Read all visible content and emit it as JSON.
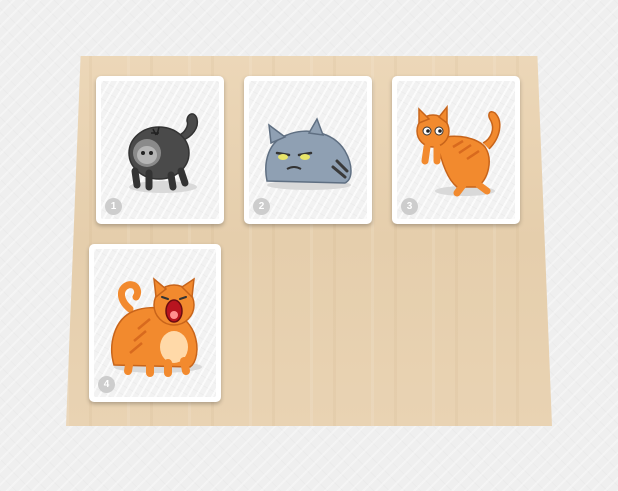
{
  "cards": [
    {
      "number": "1",
      "cat": "black-cat-icon"
    },
    {
      "number": "2",
      "cat": "grumpy-gray-cat-icon"
    },
    {
      "number": "3",
      "cat": "orange-cat-leaping-icon"
    },
    {
      "number": "4",
      "cat": "orange-cat-yawning-icon"
    }
  ],
  "colors": {
    "board": "#e8d2b2",
    "card": "#ffffff",
    "badge": "#cdcdcd",
    "orange_cat": "#f28a2e",
    "gray_cat": "#8fa0b3",
    "black_cat": "#4a4a4a"
  }
}
